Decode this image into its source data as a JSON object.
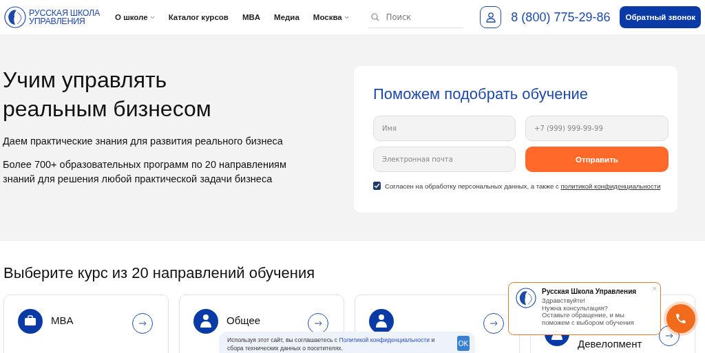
{
  "header": {
    "logo_text": [
      "РУССКАЯ ШКОЛА",
      "УПРАВЛЕНИЯ"
    ],
    "nav": [
      {
        "label": "О школе",
        "dropdown": true
      },
      {
        "label": "Каталог курсов",
        "dropdown": false
      },
      {
        "label": "MBA",
        "dropdown": false
      },
      {
        "label": "Медиа",
        "dropdown": false
      },
      {
        "label": "Москва",
        "dropdown": true
      }
    ],
    "search": {
      "placeholder": "Поиск"
    },
    "phone": "8 (800) 775-29-86",
    "callback_button": "Обратный звонок"
  },
  "hero": {
    "title": [
      "Учим управлять",
      "реальным бизнесом"
    ],
    "lead": "Даем практические знания для развития реального бизнеса",
    "text": "Более 700+ образовательных программ по 20 направлениям знаний для решения любой практической задачи бизнеса"
  },
  "form": {
    "title": "Поможем подобрать обучение",
    "fields": [
      {
        "placeholder": "Имя"
      },
      {
        "placeholder": "+7 (999) 999-99-99"
      },
      {
        "placeholder": "Электронная почта"
      }
    ],
    "submit": "Отправить",
    "consent": {
      "checked": true,
      "text": "Согласен на обработку персональных данных, а также с ",
      "link": "политикой конфиденциальности"
    }
  },
  "courses": {
    "title": "Выберите курс из 20 направлений обучения",
    "cards": [
      {
        "title": "MBA",
        "kind": "briefcase"
      },
      {
        "title": "Общее",
        "kind": "person"
      },
      {
        "kind": "person"
      },
      {
        "title": "Девелопмент",
        "kind": "person"
      }
    ]
  },
  "cookie": {
    "text": "Используя этот сайт, вы соглашаетесь с ",
    "link": "Политикой конфиденциальности",
    "text_after": " и сбора технических данных о посетителях.",
    "button": "OK"
  },
  "chat": {
    "name": "Русская Школа Управления",
    "lines": [
      "Здравствуйте!",
      "Нужна консультация?",
      "Оставьте обращение, и мы",
      "поможем с выбором обучения"
    ],
    "close": "×"
  }
}
